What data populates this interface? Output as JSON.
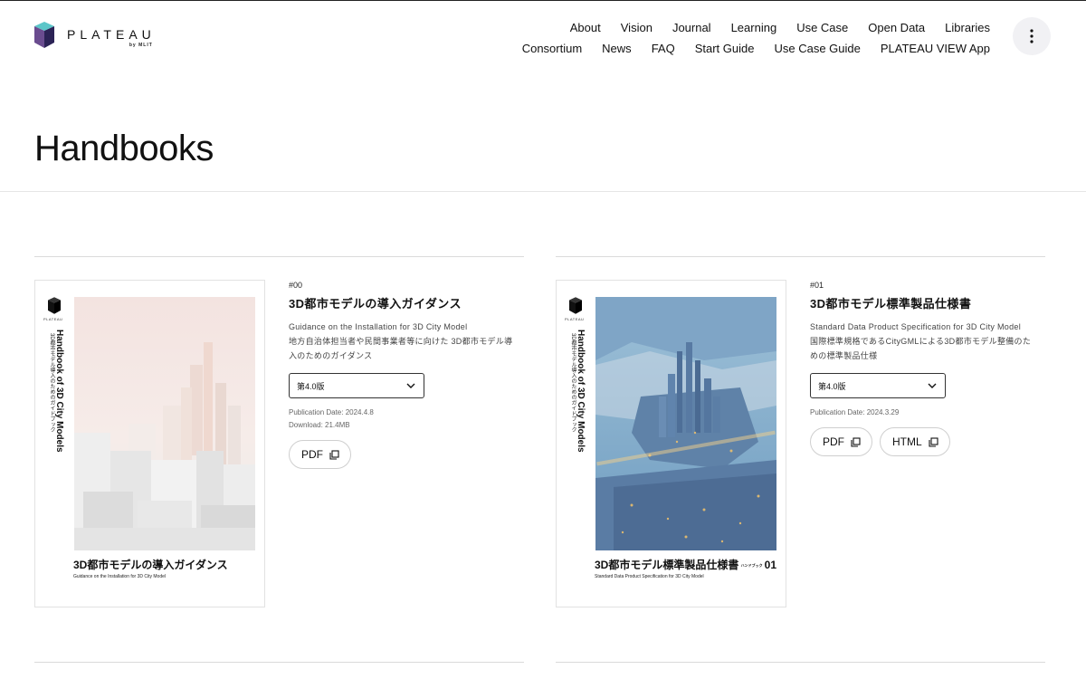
{
  "brand": {
    "name": "PLATEAU",
    "byline": "by MLIT"
  },
  "nav": {
    "row1": [
      "About",
      "Vision",
      "Journal",
      "Learning",
      "Use Case",
      "Open Data",
      "Libraries"
    ],
    "row2": [
      "Consortium",
      "News",
      "FAQ",
      "Start Guide",
      "Use Case Guide",
      "PLATEAU VIEW App"
    ]
  },
  "page": {
    "title": "Handbooks"
  },
  "cards": [
    {
      "num": "#00",
      "title": "3D都市モデルの導入ガイダンス",
      "desc_en": "Guidance on the Installation for 3D City Model",
      "desc_ja": "地方自治体担当者や民間事業者等に向けた 3D都市モデル導入のためのガイダンス",
      "version": "第4.0版",
      "pub_date": "Publication Date: 2024.4.8",
      "download": "Download: 21.4MB",
      "buttons": [
        "PDF"
      ],
      "cover": {
        "side_title": "Handbook of 3D City Models",
        "side_sub": "3D都市モデル導入のためのガイドブック",
        "logo_sub": "PLATEAU",
        "title": "3D都市モデルの導入ガイダンス",
        "subtitle": "Guidance on the Installation for 3D City Model"
      }
    },
    {
      "num": "#01",
      "title": "3D都市モデル標準製品仕様書",
      "desc_en": "Standard Data Product Specification for 3D City Model",
      "desc_ja": "国際標準規格であるCityGMLによる3D都市モデル整備のための標準製品仕様",
      "version": "第4.0版",
      "pub_date": "Publication Date: 2024.3.29",
      "buttons": [
        "PDF",
        "HTML"
      ],
      "cover": {
        "side_title": "Handbook of 3D City Models",
        "side_sub": "3D都市モデル導入のためのガイドブック",
        "logo_sub": "PLATEAU",
        "title": "3D都市モデル標準製品仕様書",
        "subtitle": "Standard Data Product Specification for 3D City Model",
        "series_label": "ハンドブック",
        "series_num": "01"
      }
    }
  ],
  "icons": {
    "menu": "more-vertical-icon",
    "select": "chevron-down-icon",
    "external": "copy-window-icon"
  }
}
